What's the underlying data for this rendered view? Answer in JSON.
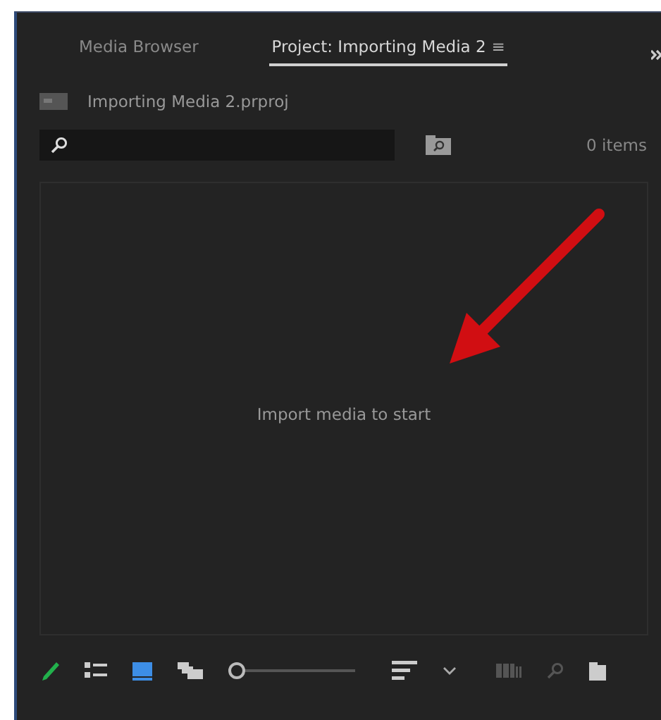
{
  "tabs": [
    {
      "label": "Media Browser",
      "selected": false
    },
    {
      "label": "Project: Importing Media 2",
      "selected": true,
      "menu": "≡"
    }
  ],
  "project": {
    "name": "Importing Media 2.prproj"
  },
  "search": {
    "item_count": "0 items"
  },
  "content": {
    "message": "Import media to start"
  },
  "toolbar": {
    "views": [
      {
        "kind": "list",
        "selected": false
      },
      {
        "kind": "icon",
        "selected": true
      },
      {
        "kind": "freeform",
        "selected": false
      }
    ],
    "zoom": {
      "level": 0
    }
  }
}
